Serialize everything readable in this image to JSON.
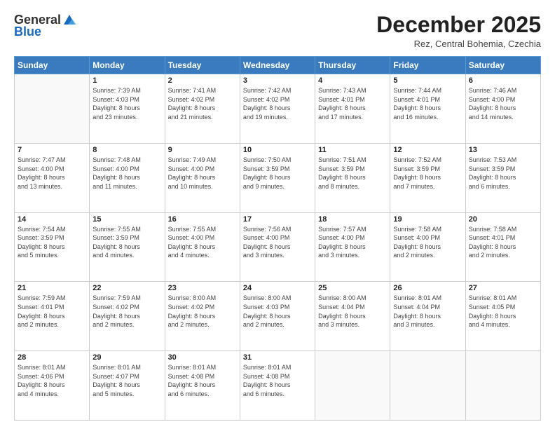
{
  "header": {
    "logo_general": "General",
    "logo_blue": "Blue",
    "month": "December 2025",
    "location": "Rez, Central Bohemia, Czechia"
  },
  "days_of_week": [
    "Sunday",
    "Monday",
    "Tuesday",
    "Wednesday",
    "Thursday",
    "Friday",
    "Saturday"
  ],
  "weeks": [
    [
      {
        "day": "",
        "info": ""
      },
      {
        "day": "1",
        "info": "Sunrise: 7:39 AM\nSunset: 4:03 PM\nDaylight: 8 hours\nand 23 minutes."
      },
      {
        "day": "2",
        "info": "Sunrise: 7:41 AM\nSunset: 4:02 PM\nDaylight: 8 hours\nand 21 minutes."
      },
      {
        "day": "3",
        "info": "Sunrise: 7:42 AM\nSunset: 4:02 PM\nDaylight: 8 hours\nand 19 minutes."
      },
      {
        "day": "4",
        "info": "Sunrise: 7:43 AM\nSunset: 4:01 PM\nDaylight: 8 hours\nand 17 minutes."
      },
      {
        "day": "5",
        "info": "Sunrise: 7:44 AM\nSunset: 4:01 PM\nDaylight: 8 hours\nand 16 minutes."
      },
      {
        "day": "6",
        "info": "Sunrise: 7:46 AM\nSunset: 4:00 PM\nDaylight: 8 hours\nand 14 minutes."
      }
    ],
    [
      {
        "day": "7",
        "info": "Sunrise: 7:47 AM\nSunset: 4:00 PM\nDaylight: 8 hours\nand 13 minutes."
      },
      {
        "day": "8",
        "info": "Sunrise: 7:48 AM\nSunset: 4:00 PM\nDaylight: 8 hours\nand 11 minutes."
      },
      {
        "day": "9",
        "info": "Sunrise: 7:49 AM\nSunset: 4:00 PM\nDaylight: 8 hours\nand 10 minutes."
      },
      {
        "day": "10",
        "info": "Sunrise: 7:50 AM\nSunset: 3:59 PM\nDaylight: 8 hours\nand 9 minutes."
      },
      {
        "day": "11",
        "info": "Sunrise: 7:51 AM\nSunset: 3:59 PM\nDaylight: 8 hours\nand 8 minutes."
      },
      {
        "day": "12",
        "info": "Sunrise: 7:52 AM\nSunset: 3:59 PM\nDaylight: 8 hours\nand 7 minutes."
      },
      {
        "day": "13",
        "info": "Sunrise: 7:53 AM\nSunset: 3:59 PM\nDaylight: 8 hours\nand 6 minutes."
      }
    ],
    [
      {
        "day": "14",
        "info": "Sunrise: 7:54 AM\nSunset: 3:59 PM\nDaylight: 8 hours\nand 5 minutes."
      },
      {
        "day": "15",
        "info": "Sunrise: 7:55 AM\nSunset: 3:59 PM\nDaylight: 8 hours\nand 4 minutes."
      },
      {
        "day": "16",
        "info": "Sunrise: 7:55 AM\nSunset: 4:00 PM\nDaylight: 8 hours\nand 4 minutes."
      },
      {
        "day": "17",
        "info": "Sunrise: 7:56 AM\nSunset: 4:00 PM\nDaylight: 8 hours\nand 3 minutes."
      },
      {
        "day": "18",
        "info": "Sunrise: 7:57 AM\nSunset: 4:00 PM\nDaylight: 8 hours\nand 3 minutes."
      },
      {
        "day": "19",
        "info": "Sunrise: 7:58 AM\nSunset: 4:00 PM\nDaylight: 8 hours\nand 2 minutes."
      },
      {
        "day": "20",
        "info": "Sunrise: 7:58 AM\nSunset: 4:01 PM\nDaylight: 8 hours\nand 2 minutes."
      }
    ],
    [
      {
        "day": "21",
        "info": "Sunrise: 7:59 AM\nSunset: 4:01 PM\nDaylight: 8 hours\nand 2 minutes."
      },
      {
        "day": "22",
        "info": "Sunrise: 7:59 AM\nSunset: 4:02 PM\nDaylight: 8 hours\nand 2 minutes."
      },
      {
        "day": "23",
        "info": "Sunrise: 8:00 AM\nSunset: 4:02 PM\nDaylight: 8 hours\nand 2 minutes."
      },
      {
        "day": "24",
        "info": "Sunrise: 8:00 AM\nSunset: 4:03 PM\nDaylight: 8 hours\nand 2 minutes."
      },
      {
        "day": "25",
        "info": "Sunrise: 8:00 AM\nSunset: 4:04 PM\nDaylight: 8 hours\nand 3 minutes."
      },
      {
        "day": "26",
        "info": "Sunrise: 8:01 AM\nSunset: 4:04 PM\nDaylight: 8 hours\nand 3 minutes."
      },
      {
        "day": "27",
        "info": "Sunrise: 8:01 AM\nSunset: 4:05 PM\nDaylight: 8 hours\nand 4 minutes."
      }
    ],
    [
      {
        "day": "28",
        "info": "Sunrise: 8:01 AM\nSunset: 4:06 PM\nDaylight: 8 hours\nand 4 minutes."
      },
      {
        "day": "29",
        "info": "Sunrise: 8:01 AM\nSunset: 4:07 PM\nDaylight: 8 hours\nand 5 minutes."
      },
      {
        "day": "30",
        "info": "Sunrise: 8:01 AM\nSunset: 4:08 PM\nDaylight: 8 hours\nand 6 minutes."
      },
      {
        "day": "31",
        "info": "Sunrise: 8:01 AM\nSunset: 4:08 PM\nDaylight: 8 hours\nand 6 minutes."
      },
      {
        "day": "",
        "info": ""
      },
      {
        "day": "",
        "info": ""
      },
      {
        "day": "",
        "info": ""
      }
    ]
  ]
}
